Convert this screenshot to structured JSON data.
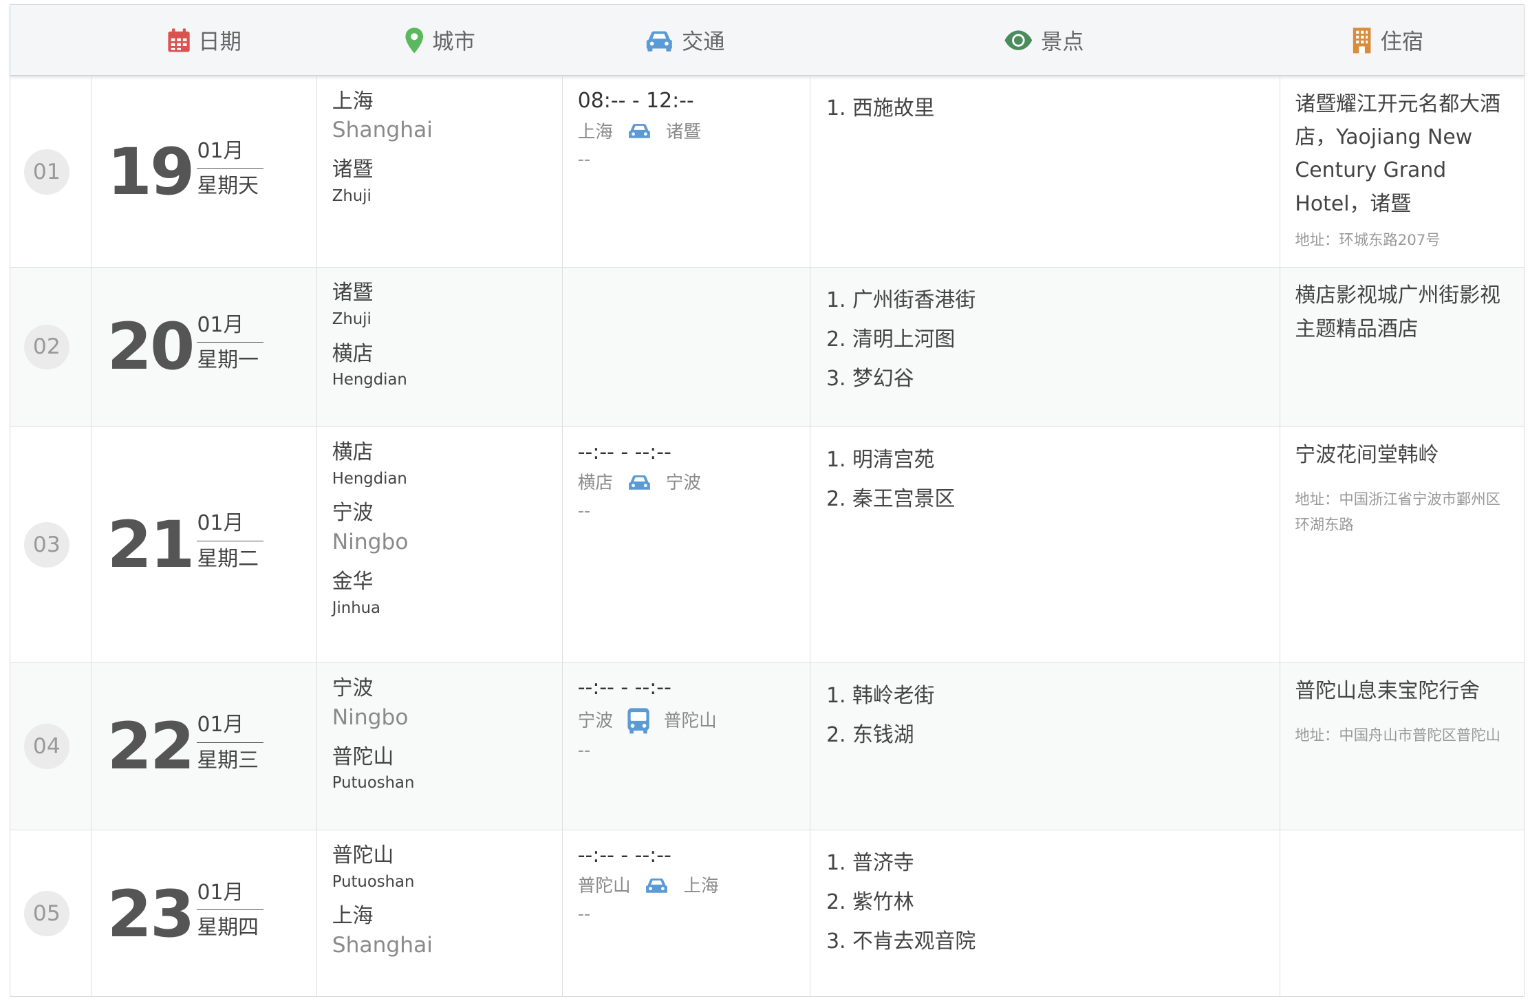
{
  "header": {
    "date": "日期",
    "city": "城市",
    "transport": "交通",
    "sights": "景点",
    "lodging": "住宿"
  },
  "colors": {
    "calendar": "#d9534f",
    "pin": "#5cb85c",
    "car": "#5b9bd5",
    "eye": "#4a8c5c",
    "hotel": "#d98c3a"
  },
  "days": [
    {
      "num": "01",
      "day": "19",
      "month": "01月",
      "weekday": "星期天",
      "cities": [
        {
          "cn": "上海",
          "en": "Shanghai"
        },
        {
          "cn": "诸暨",
          "en": "Zhuji"
        }
      ],
      "transport": {
        "time": "08:-- - 12:--",
        "from": "上海",
        "to": "诸暨",
        "vehicle": "car-icon",
        "note": "--"
      },
      "sights": [
        "1. 西施故里"
      ],
      "hotel": {
        "name": "诸暨耀江开元名都大酒店，Yaojiang New Century Grand Hotel，诸暨",
        "address": "地址：环城东路207号"
      }
    },
    {
      "num": "02",
      "day": "20",
      "month": "01月",
      "weekday": "星期一",
      "cities": [
        {
          "cn": "诸暨",
          "en": "Zhuji"
        },
        {
          "cn": "横店",
          "en": "Hengdian"
        }
      ],
      "transport": null,
      "sights": [
        "1. 广州街香港街",
        "2. 清明上河图",
        "3. 梦幻谷"
      ],
      "hotel": {
        "name": "横店影视城广州街影视主题精品酒店",
        "address": ""
      }
    },
    {
      "num": "03",
      "day": "21",
      "month": "01月",
      "weekday": "星期二",
      "cities": [
        {
          "cn": "横店",
          "en": "Hengdian"
        },
        {
          "cn": "宁波",
          "en": "Ningbo"
        },
        {
          "cn": "金华",
          "en": "Jinhua"
        }
      ],
      "transport": {
        "time": "--:-- - --:--",
        "from": "横店",
        "to": "宁波",
        "vehicle": "car-icon",
        "note": "--"
      },
      "sights": [
        "1. 明清宫苑",
        "2. 秦王宫景区"
      ],
      "hotel": {
        "name": "宁波花间堂韩岭",
        "address": "地址：中国浙江省宁波市鄞州区环湖东路"
      }
    },
    {
      "num": "04",
      "day": "22",
      "month": "01月",
      "weekday": "星期三",
      "cities": [
        {
          "cn": "宁波",
          "en": "Ningbo"
        },
        {
          "cn": "普陀山",
          "en": "Putuoshan"
        }
      ],
      "transport": {
        "time": "--:-- - --:--",
        "from": "宁波",
        "to": "普陀山",
        "vehicle": "bus-icon",
        "note": "--"
      },
      "sights": [
        "1. 韩岭老街",
        "2. 东钱湖"
      ],
      "hotel": {
        "name": "普陀山息耒宝陀行舍",
        "address": "地址：中国舟山市普陀区普陀山"
      }
    },
    {
      "num": "05",
      "day": "23",
      "month": "01月",
      "weekday": "星期四",
      "cities": [
        {
          "cn": "普陀山",
          "en": "Putuoshan"
        },
        {
          "cn": "上海",
          "en": "Shanghai"
        }
      ],
      "transport": {
        "time": "--:-- - --:--",
        "from": "普陀山",
        "to": "上海",
        "vehicle": "car-icon",
        "note": "--"
      },
      "sights": [
        "1. 普济寺",
        "2. 紫竹林",
        "3. 不肯去观音院"
      ],
      "hotel": null
    }
  ]
}
